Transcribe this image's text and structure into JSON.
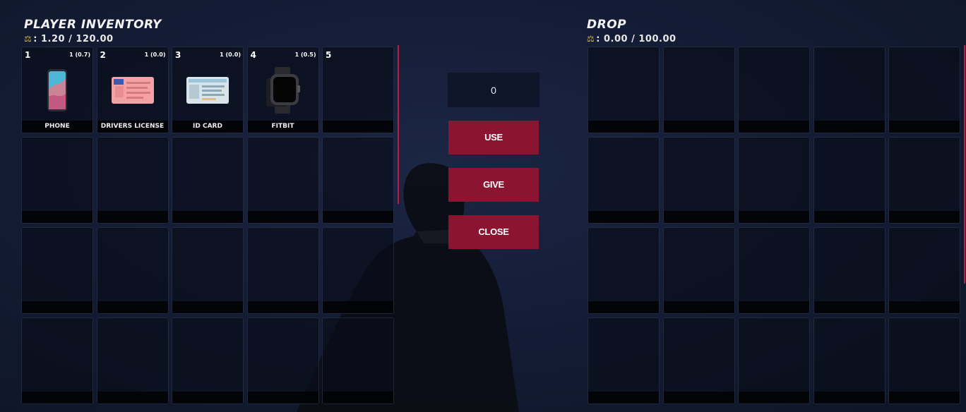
{
  "player": {
    "title": "PLAYER INVENTORY",
    "weight": ": 1.20 / 120.00",
    "slots": [
      {
        "num": "1",
        "qty": "1 (0.7)",
        "label": "PHONE",
        "icon": "phone-icon"
      },
      {
        "num": "2",
        "qty": "1 (0.0)",
        "label": "DRIVERS LICENSE",
        "icon": "drivers-license-icon"
      },
      {
        "num": "3",
        "qty": "1 (0.0)",
        "label": "ID CARD",
        "icon": "id-card-icon"
      },
      {
        "num": "4",
        "qty": "1 (0.5)",
        "label": "FITBIT",
        "icon": "smartwatch-icon"
      },
      {
        "num": "5",
        "qty": "",
        "label": "",
        "icon": ""
      }
    ]
  },
  "drop": {
    "title": "DROP",
    "weight": ": 0.00 / 100.00"
  },
  "actions": {
    "amount_value": "0",
    "use_label": "USE",
    "give_label": "GIVE",
    "close_label": "CLOSE"
  },
  "colors": {
    "accent": "#8b1530",
    "scrollbar": "#c21a3d",
    "weight_icon": "#d8b24a"
  }
}
